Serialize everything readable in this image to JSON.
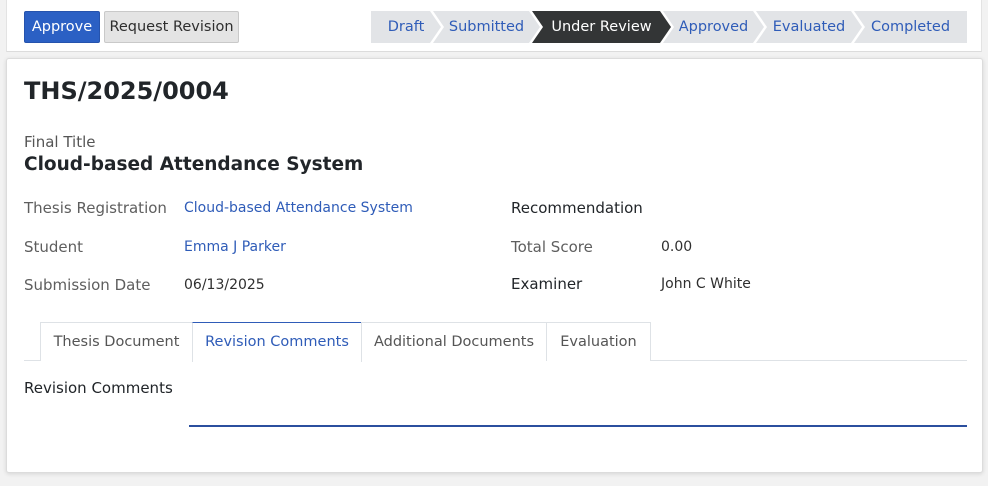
{
  "toolbar": {
    "approve_label": "Approve",
    "request_revision_label": "Request Revision"
  },
  "statusbar": {
    "stages": [
      "Draft",
      "Submitted",
      "Under Review",
      "Approved",
      "Evaluated",
      "Completed"
    ],
    "active": "Under Review"
  },
  "record": {
    "reference": "THS/2025/0004",
    "final_title_label": "Final Title",
    "final_title": "Cloud-based Attendance System"
  },
  "fields": {
    "thesis_registration_label": "Thesis Registration",
    "thesis_registration": "Cloud-based Attendance System",
    "student_label": "Student",
    "student": "Emma J Parker",
    "submission_date_label": "Submission Date",
    "submission_date": "06/13/2025",
    "recommendation_label": "Recommendation",
    "recommendation": "",
    "total_score_label": "Total Score",
    "total_score": "0.00",
    "examiner_label": "Examiner",
    "examiner": "John C White"
  },
  "tabs": {
    "items": [
      "Thesis Document",
      "Revision Comments",
      "Additional Documents",
      "Evaluation"
    ],
    "active": "Revision Comments"
  },
  "revision": {
    "label": "Revision Comments",
    "value": ""
  },
  "colors": {
    "primary": "#2b60c4",
    "link": "#2f5cb8",
    "active_stage": "#333536",
    "stage_bg": "#e2e4e7"
  }
}
